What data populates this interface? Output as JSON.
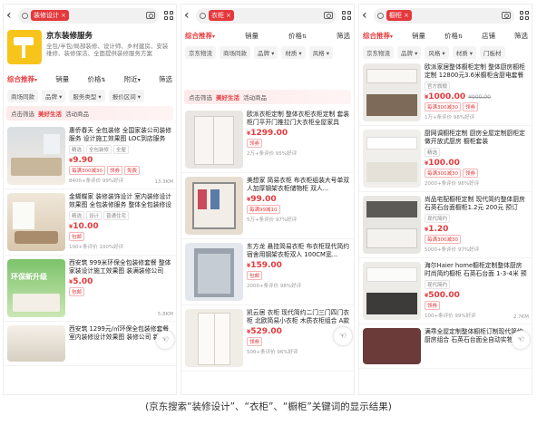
{
  "colors": {
    "accent": "#e4393c",
    "logo": "#f7c41c"
  },
  "screens": [
    {
      "keyword": "装修设计",
      "sort": [
        "综合推荐",
        "销量",
        "价格",
        "附近",
        "筛选"
      ],
      "filters": [
        "商场同款",
        "品牌",
        "服务类型",
        "报价区间"
      ],
      "shop": {
        "name": "京东装修服务",
        "desc": "全包/半包/局部装修、设计师、乡村建房、安装维修、装修保洁、全面提供装修服务方案"
      },
      "banner": {
        "prefix": "点击筛选",
        "highlight": "美好生活",
        "suffix": "活动商品"
      },
      "items": [
        {
          "title": "惠侨春天 全包装修 全国家装公司装修服务 设计施工效果图 LOC到店服务 送回自选",
          "tags": [
            "精选",
            "全包装修",
            "全屋"
          ],
          "price": "9.90",
          "old": "",
          "promo": [
            "每满300减30",
            "领券",
            "免费"
          ],
          "meta": "8400+条评价 99%好评",
          "side": "13.3KM"
        },
        {
          "title": "金蝴蝶家 装修装饰设计 室内装修设计效果图 全包装修服务 整体全包装修设计",
          "tags": [
            "精选",
            "设计",
            "普通住宅"
          ],
          "price": "10.00",
          "old": "",
          "promo": [
            "包邮"
          ],
          "meta": "100+条评价 100%好评",
          "side": ""
        },
        {
          "title": "西安筑 999米环保全包装修套餐 整体家装设计施工效果图 装满装修公司 新...",
          "tags": [],
          "price": "5.00",
          "old": "",
          "promo": [
            "包邮"
          ],
          "meta": "",
          "side": "5.8KM"
        },
        {
          "title": "西安筑 1299元/㎡环保全包装修套餐 室内装修设计效果图 装修公司 新...",
          "tags": [],
          "price": "",
          "old": "",
          "promo": [],
          "meta": "",
          "side": ""
        }
      ],
      "banner_text": "环保新升级"
    },
    {
      "keyword": "衣柜",
      "sort": [
        "综合推荐",
        "销量",
        "价格",
        "筛选"
      ],
      "filters": [
        "京东物流",
        "商场同款",
        "品牌",
        "材质",
        "风格"
      ],
      "banner": {
        "prefix": "点击筛选",
        "highlight": "美好生活",
        "suffix": "活动商品"
      },
      "items": [
        {
          "title": "欧派衣柜定制 整体衣柜衣柜定制 套装柜门平开门推拉门大衣柜全屋家具定...",
          "tags": [],
          "price": "1299.00",
          "old": "",
          "promo": [
            "领券"
          ],
          "meta": "2万+条评价 95%好评",
          "side": ""
        },
        {
          "title": "美想家 简易衣柜 布衣柜组装大号单双人加厚钢架衣柜储物柜 双人...",
          "tags": [],
          "price": "99.00",
          "old": "",
          "promo": [
            "每满99减10"
          ],
          "meta": "5万+条评价 97%好评",
          "side": ""
        },
        {
          "title": "东方龙 悬挂简易衣柜 布衣柜现代简约 宿舍用钢架衣柜双人 100CM宽...",
          "tags": [],
          "price": "159.00",
          "old": "",
          "promo": [
            "包邮"
          ],
          "meta": "2000+条评价 98%好评",
          "side": ""
        },
        {
          "title": "凯云居 衣柜 现代简约二门三门四门衣柜 北欧简易小衣柜 木质衣柜组合 A款",
          "tags": [],
          "price": "529.00",
          "old": "",
          "promo": [
            "领券"
          ],
          "meta": "500+条评价 96%好评",
          "side": ""
        }
      ]
    },
    {
      "keyword": "橱柜",
      "sort": [
        "综合推荐",
        "销量",
        "价格",
        "店铺",
        "筛选"
      ],
      "filters": [
        "京东物流",
        "品牌",
        "风格",
        "材质",
        "门板材"
      ],
      "items": [
        {
          "title": "欧派家居整体橱柜定制 整体厨房橱柜定制 12800元3.6米橱柜含厨电套餐套餐...",
          "tags": [
            "官方旗舰"
          ],
          "price": "1000.00",
          "old": "¥900.00",
          "promo": [
            "每满300减30",
            "领券"
          ],
          "meta": "1万+条评价 98%好评",
          "side": ""
        },
        {
          "title": "厨网调橱柜定制 厨房全屋定制厨柜定做开放式厨房 橱柜套装",
          "tags": [
            "精选"
          ],
          "price": "100.00",
          "old": "",
          "promo": [
            "每满300减30",
            "领券"
          ],
          "meta": "2000+条评价 96%好评",
          "side": ""
        },
        {
          "title": "尚品宅配橱柜定制 现代简约整体厨房 石英石台面橱柜1.2元 200元 预订金...",
          "tags": [
            "现代简约"
          ],
          "price": "1.20",
          "old": "",
          "promo": [
            "每满300减30"
          ],
          "meta": "5000+条评价 97%好评",
          "side": ""
        },
        {
          "title": "海尔Haier home橱柜定制整体厨房时尚简约橱柜 石英石台面 1-3-4米 预付金...",
          "tags": [
            "现代简约"
          ],
          "price": "500.00",
          "old": "",
          "promo": [
            "领券"
          ],
          "meta": "100+条评价 99%好评",
          "side": "2.7KM"
        },
        {
          "title": "满乖全屋定制整体橱柜订制现代简约厨房组合 石英石台面全自动实物橱柜北欧...",
          "tags": [],
          "price": "",
          "old": "",
          "promo": [],
          "meta": "",
          "side": ""
        }
      ]
    }
  ],
  "caption": "(京东搜索“装修设计”、“衣柜”、“橱柜”关键词的显示结果)"
}
